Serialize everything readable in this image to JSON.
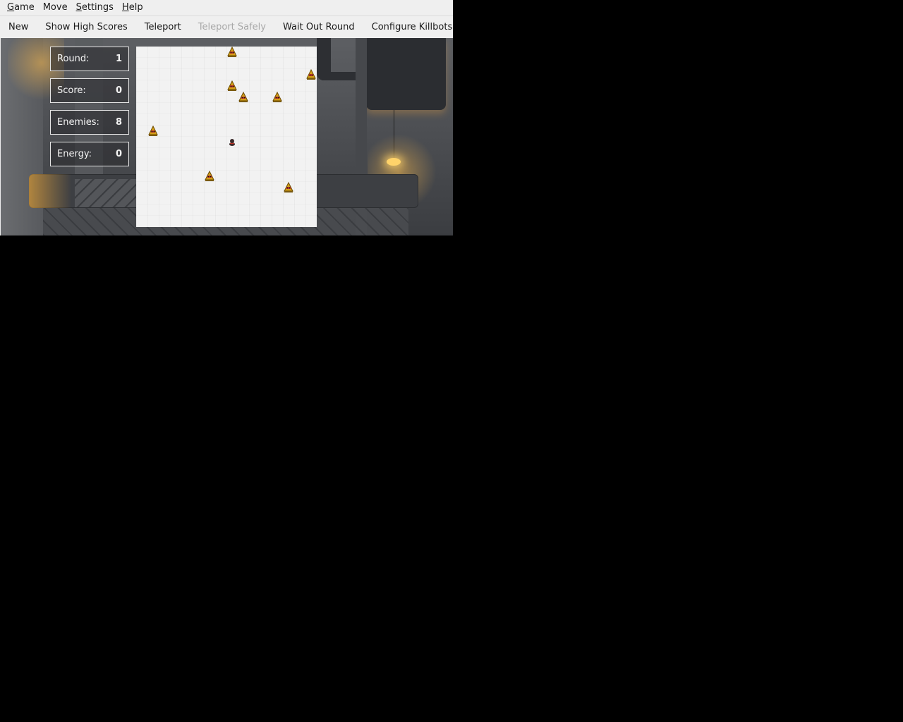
{
  "menubar": {
    "items": [
      {
        "label": "Game",
        "mnemonic": "G",
        "rest": "ame"
      },
      {
        "label": "Move",
        "mnemonic": "",
        "rest": "Move"
      },
      {
        "label": "Settings",
        "mnemonic": "S",
        "rest": "ettings"
      },
      {
        "label": "Help",
        "mnemonic": "H",
        "rest": "elp"
      }
    ]
  },
  "toolbar": {
    "new_label": "New",
    "high_scores_label": "Show High Scores",
    "teleport_label": "Teleport",
    "teleport_safely_label": "Teleport Safely",
    "wait_out_label": "Wait Out Round",
    "configure_label": "Configure Killbots"
  },
  "stats": {
    "round_label": "Round:",
    "round_value": "1",
    "score_label": "Score:",
    "score_value": "0",
    "enemies_label": "Enemies:",
    "enemies_value": "8",
    "energy_label": "Energy:",
    "energy_value": "0"
  },
  "arena": {
    "grid_columns": 16,
    "grid_rows": 16,
    "hero": {
      "col": 8,
      "row": 8
    },
    "enemies": [
      {
        "col": 8,
        "row": 0
      },
      {
        "col": 15,
        "row": 2
      },
      {
        "col": 8,
        "row": 3
      },
      {
        "col": 9,
        "row": 4
      },
      {
        "col": 12,
        "row": 4
      },
      {
        "col": 1,
        "row": 7
      },
      {
        "col": 6,
        "row": 11
      },
      {
        "col": 13,
        "row": 12
      }
    ]
  },
  "colors": {
    "enemy_body": "#d4a017",
    "enemy_accent": "#c0392b",
    "hero": "#3a2a2a",
    "lamp": "#ffd36a"
  }
}
